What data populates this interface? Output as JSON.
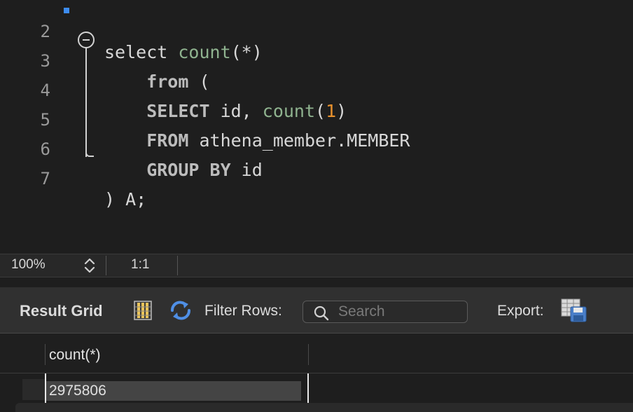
{
  "editor": {
    "lines": [
      {
        "num": "2",
        "tokens": [
          {
            "t": "select ",
            "c": "plain"
          },
          {
            "t": "count",
            "c": "fn"
          },
          {
            "t": "(*)",
            "c": "plain"
          }
        ]
      },
      {
        "num": "3",
        "tokens": [
          {
            "t": "    from",
            "c": "kw"
          },
          {
            "t": " (",
            "c": "plain"
          }
        ]
      },
      {
        "num": "4",
        "tokens": [
          {
            "t": "    SELECT",
            "c": "kw"
          },
          {
            "t": " id, ",
            "c": "plain"
          },
          {
            "t": "count",
            "c": "fn"
          },
          {
            "t": "(",
            "c": "plain"
          },
          {
            "t": "1",
            "c": "num"
          },
          {
            "t": ")",
            "c": "plain"
          }
        ]
      },
      {
        "num": "5",
        "tokens": [
          {
            "t": "    FROM",
            "c": "kw"
          },
          {
            "t": " athena_member.MEMBER",
            "c": "plain"
          }
        ]
      },
      {
        "num": "6",
        "tokens": [
          {
            "t": "    GROUP BY",
            "c": "kw"
          },
          {
            "t": " id",
            "c": "plain"
          }
        ]
      },
      {
        "num": "7",
        "tokens": [
          {
            "t": ") A;",
            "c": "plain"
          }
        ]
      }
    ]
  },
  "status": {
    "zoom": "100%",
    "position": "1:1"
  },
  "toolbar": {
    "result_grid_label": "Result Grid",
    "filter_rows_label": "Filter Rows:",
    "search_placeholder": "Search",
    "export_label": "Export:",
    "icons": {
      "columns": "grid-columns-icon",
      "refresh": "refresh-icon",
      "search": "search-icon",
      "export": "export-save-icon"
    }
  },
  "grid": {
    "columns": [
      "count(*)"
    ],
    "rows": [
      [
        "2975806"
      ]
    ]
  },
  "colors": {
    "background": "#1e1e1e",
    "keyword": "#bcbcbc",
    "function": "#8fb38f",
    "number": "#e8912d",
    "marker": "#3d8cf0"
  }
}
